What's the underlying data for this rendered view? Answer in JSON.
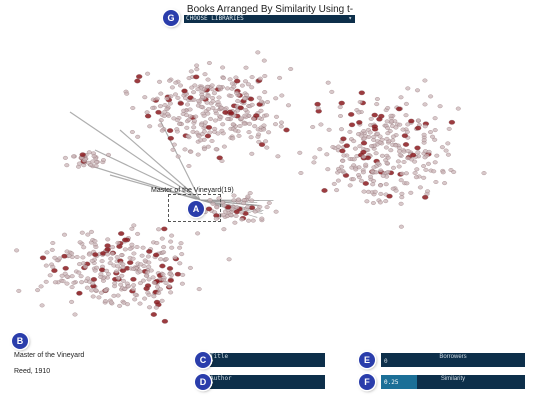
{
  "header": {
    "title": "Books Arranged By Similarity Using t-SNE",
    "libraries_label": "CHOOSE LIBRARIES",
    "caret_icon": "caret-down-icon"
  },
  "badges": {
    "g": "G",
    "a": "A",
    "b": "B",
    "c": "C",
    "d": "D",
    "e": "E",
    "f": "F"
  },
  "hover": {
    "label": "Master of the Vineyard(19)"
  },
  "selected_book": {
    "title": "Master of the Vineyard",
    "meta": "Reed, 1910"
  },
  "filters": {
    "title": {
      "label": "Title",
      "value": "?"
    },
    "author": {
      "label": "Author",
      "value": "?"
    },
    "borrowers": {
      "label": "Borrowers",
      "value": "0"
    },
    "similarity": {
      "label": "Similarity",
      "value": "0.25",
      "level": 0.25
    }
  },
  "colors": {
    "panel": "#0d2f4a",
    "badge": "#2a3dab",
    "dot_light": "#cbb5b8",
    "dot_dark": "#8b1a1f",
    "link": "#9a9a9a"
  }
}
